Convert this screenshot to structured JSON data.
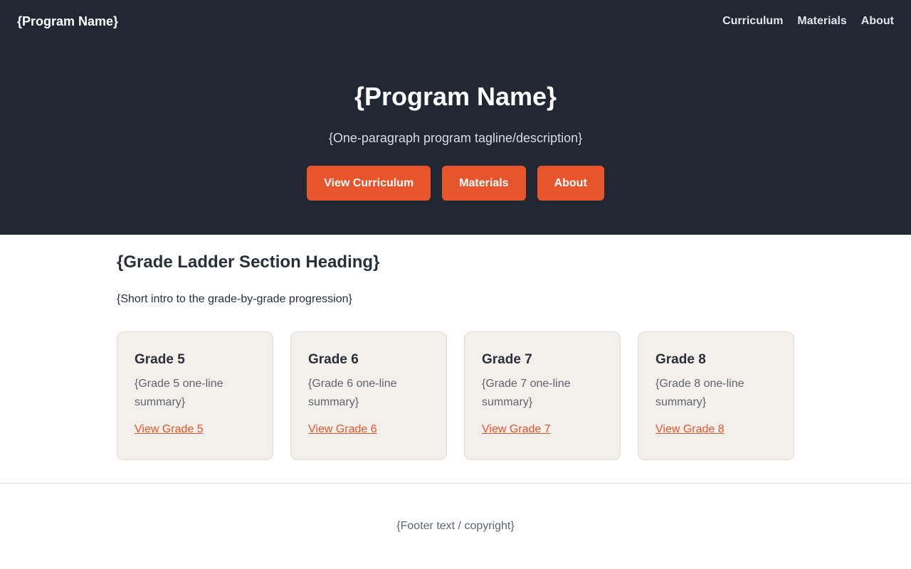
{
  "header": {
    "brand": "{Program Name}",
    "nav": [
      {
        "label": "Curriculum"
      },
      {
        "label": "Materials"
      },
      {
        "label": "About"
      }
    ]
  },
  "hero": {
    "title": "{Program Name}",
    "tagline": "{One-paragraph program tagline/description}",
    "buttons": [
      {
        "label": "View Curriculum"
      },
      {
        "label": "Materials"
      },
      {
        "label": "About"
      }
    ]
  },
  "grade_ladder": {
    "heading": "{Grade Ladder Section Heading}",
    "intro": "{Short intro to the grade-by-grade progression}",
    "cards": [
      {
        "title": "Grade 5",
        "summary": "{Grade 5 one-line summary}",
        "link": "View Grade 5"
      },
      {
        "title": "Grade 6",
        "summary": "{Grade 6 one-line summary}",
        "link": "View Grade 6"
      },
      {
        "title": "Grade 7",
        "summary": "{Grade 7 one-line summary}",
        "link": "View Grade 7"
      },
      {
        "title": "Grade 8",
        "summary": "{Grade 8 one-line summary}",
        "link": "View Grade 8"
      }
    ]
  },
  "footer": {
    "text": "{Footer text / copyright}"
  },
  "colors": {
    "header_bg": "#212733",
    "accent": "#e8552c",
    "card_bg": "#f3efea"
  }
}
